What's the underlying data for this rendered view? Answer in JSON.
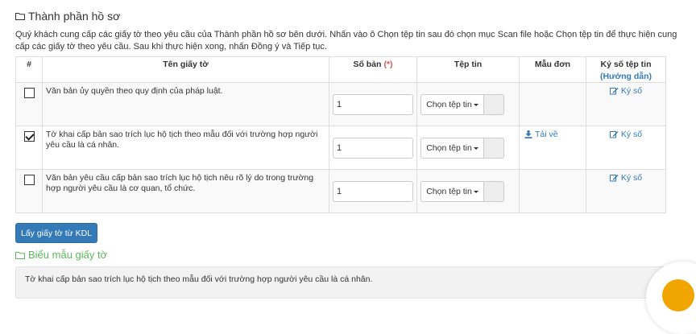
{
  "section": {
    "title": "Thành phần hồ sơ"
  },
  "intro": "Quý khách cung cấp các giấy tờ theo yêu cầu của Thành phần hồ sơ bên dưới. Nhấn vào ô Chọn tệp tin sau đó chọn mục Scan file hoặc Chọn tệp tin để thực hiện cung cấp các giấy tờ theo yêu cầu. Sau khi thực hiện xong, nhấn Đồng ý và Tiếp tục.",
  "table": {
    "headers": {
      "num": "#",
      "name": "Tên giấy tờ",
      "copies": "Số bản",
      "copies_required": "(*)",
      "file": "Tệp tin",
      "form": "Mẫu đơn",
      "sign": "Ký số tệp tin",
      "sign_guide": "(Hướng dẫn)"
    },
    "rows": [
      {
        "checked": false,
        "name": "Văn bản ủy quyền theo quy định của pháp luật.",
        "copies": "1",
        "file_button": "Chọn tệp tin",
        "form_link": "",
        "sign_link": "Ký số"
      },
      {
        "checked": true,
        "name": "Tờ khai cấp bản sao trích lục hộ tịch theo mẫu đối với trường hợp người yêu cầu là cá nhân.",
        "copies": "1",
        "file_button": "Chọn tệp tin",
        "form_link": "Tải về",
        "sign_link": "Ký số"
      },
      {
        "checked": false,
        "name": "Văn bản yêu cầu cấp bản sao trích lục hộ tịch nêu rõ lý do trong trường hợp người yêu cầu là cơ quan, tổ chức.",
        "copies": "1",
        "file_button": "Chọn tệp tin",
        "form_link": "",
        "sign_link": "Ký số"
      }
    ]
  },
  "actions": {
    "fetch_button": "Lấy giấy tờ từ KDL"
  },
  "forms_section": {
    "title": "Biểu mẫu giấy tờ",
    "item": "Tờ khai cấp bản sao trích lục hộ tịch theo mẫu đối với trường hợp người yêu cầu là cá nhân."
  },
  "colors": {
    "primary": "#337ab7",
    "required": "#d9534f",
    "section_green": "#5cb85c",
    "fab": "#f0a500"
  }
}
